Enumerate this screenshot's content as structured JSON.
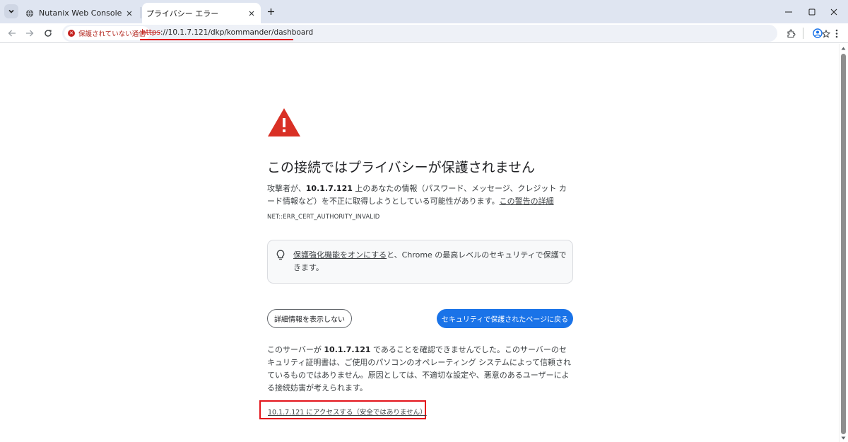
{
  "tabs": [
    {
      "title": "Nutanix Web Console",
      "active": false
    },
    {
      "title": "プライバシー エラー",
      "active": true
    }
  ],
  "toolbar": {
    "security_chip": "保護されていない通信",
    "url_scheme": "https",
    "url_rest": "://10.1.7.121/dkp/kommander/dashboard"
  },
  "page": {
    "heading": "この接続ではプライバシーが保護されません",
    "desc_prefix": "攻撃者が、",
    "desc_host": "10.1.7.121",
    "desc_suffix": " 上のあなたの情報（パスワード、メッセージ、クレジット カード情報など）を不正に取得しようとしている可能性があります。",
    "desc_link": "この警告の詳細",
    "error_code": "NET::ERR_CERT_AUTHORITY_INVALID",
    "enhanced_link": "保護強化機能をオンにする",
    "enhanced_text": "と、Chrome の最高レベルのセキュリティで保護できます。",
    "details_button": "詳細情報を表示しない",
    "back_button": "セキュリティで保護されたページに戻る",
    "server_prefix": "このサーバーが ",
    "server_host": "10.1.7.121",
    "server_suffix": " であることを確認できませんでした。このサーバーのセキュリティ証明書は、ご使用のパソコンのオペレーティング システムによって信頼されているものではありません。原因としては、不適切な設定や、悪意のあるユーザーによる接続妨害が考えられます。",
    "proceed_link": "10.1.7.121 にアクセスする（安全ではありません）"
  },
  "colors": {
    "primary_button": "#1a73e8",
    "warning_red": "#d93025",
    "annotation_red": "#e3141b"
  }
}
